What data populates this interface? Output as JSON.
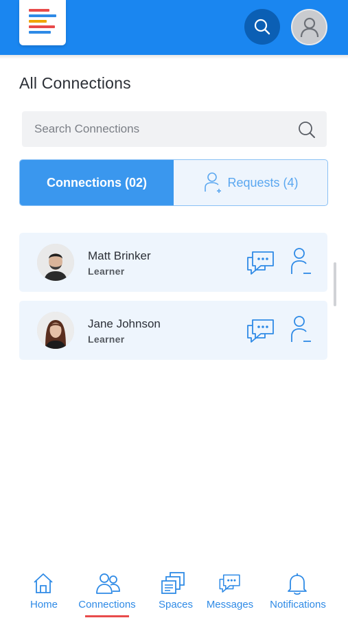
{
  "header": {
    "logo_icon": "stacked-bars-logo",
    "search_icon": "search-icon",
    "avatar_icon": "user-avatar-icon"
  },
  "page": {
    "title": "All Connections"
  },
  "search": {
    "placeholder": "Search Connections",
    "value": ""
  },
  "tabs": [
    {
      "label": "Connections (02)",
      "active": true
    },
    {
      "label": "Requests (4)",
      "active": false,
      "icon": "add-user-icon"
    }
  ],
  "connections": [
    {
      "name": "Matt Brinker",
      "role": "Learner",
      "actions": [
        "message-icon",
        "remove-user-icon"
      ]
    },
    {
      "name": "Jane Johnson",
      "role": "Learner",
      "actions": [
        "message-icon",
        "remove-user-icon"
      ]
    }
  ],
  "bottom_nav": [
    {
      "label": "Home",
      "icon": "home-icon"
    },
    {
      "label": "Connections",
      "icon": "connections-icon",
      "active": true
    },
    {
      "label": "Spaces",
      "icon": "spaces-icon"
    },
    {
      "label": "Messages",
      "icon": "messages-icon"
    },
    {
      "label": "Notifications",
      "icon": "bell-icon"
    }
  ],
  "colors": {
    "primary": "#1a86f0",
    "tab_active": "#3a97ee",
    "card_bg": "#eef5fd",
    "icon_blue": "#2e8ae6",
    "nav_active_underline": "#e84a4a"
  }
}
